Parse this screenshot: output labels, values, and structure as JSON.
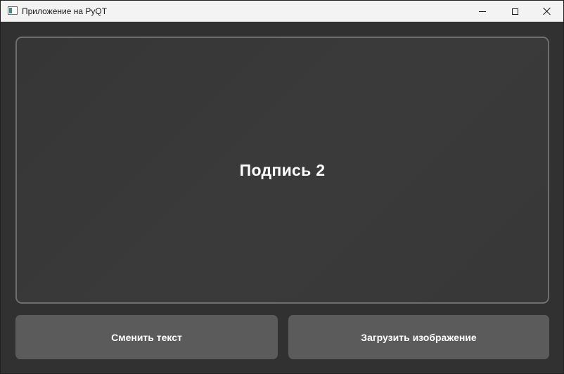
{
  "window": {
    "title": "Приложение на PyQT",
    "icon": "app-window-icon",
    "controls": {
      "minimize_icon": "minimize-icon",
      "maximize_icon": "maximize-icon",
      "close_icon": "close-icon"
    }
  },
  "main": {
    "caption": "Подпись 2"
  },
  "buttons": {
    "change_text_label": "Сменить текст",
    "load_image_label": "Загрузить изображение"
  },
  "colors": {
    "background": "#313131",
    "panel_border": "#6e6e6e",
    "button_bg": "#5b5b5b",
    "text": "#ffffff",
    "titlebar": "#f3f3f3"
  }
}
